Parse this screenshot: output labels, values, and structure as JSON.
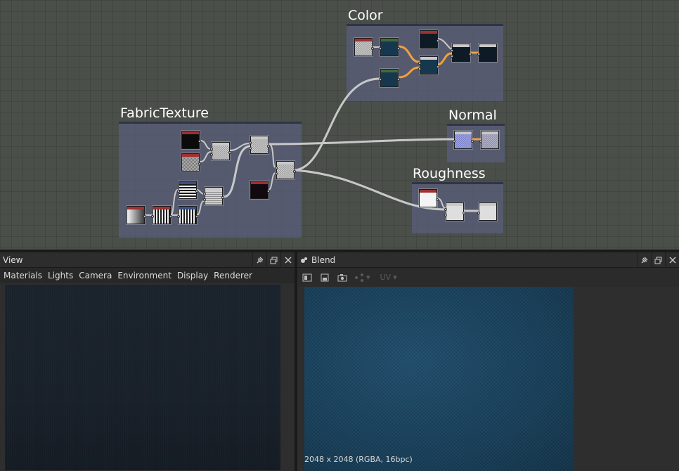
{
  "graph": {
    "frames": {
      "color": {
        "title": "Color"
      },
      "fabric": {
        "title": "FabricTexture"
      },
      "normal": {
        "title": "Normal"
      },
      "roughness": {
        "title": "Roughness"
      }
    }
  },
  "view_panel": {
    "title": "View",
    "menu": [
      "Materials",
      "Lights",
      "Camera",
      "Environment",
      "Display",
      "Renderer"
    ]
  },
  "blend_panel": {
    "title": "Blend",
    "toolbar_disabled_label": "UV",
    "status": "2048 x 2048 (RGBA, 16bpc)"
  },
  "window_buttons": {
    "pin": "pin-icon",
    "float": "float-icon",
    "close": "close-icon"
  },
  "colors": {
    "graph_bg": "#4a4f4a",
    "frame_bg": "#585d78",
    "wire": "#c8c8c8",
    "wire_active": "#f0a040",
    "node_header_red": "#a03030",
    "node_header_green": "#3d6b3a",
    "node_header_blue": "#3b4f86"
  }
}
